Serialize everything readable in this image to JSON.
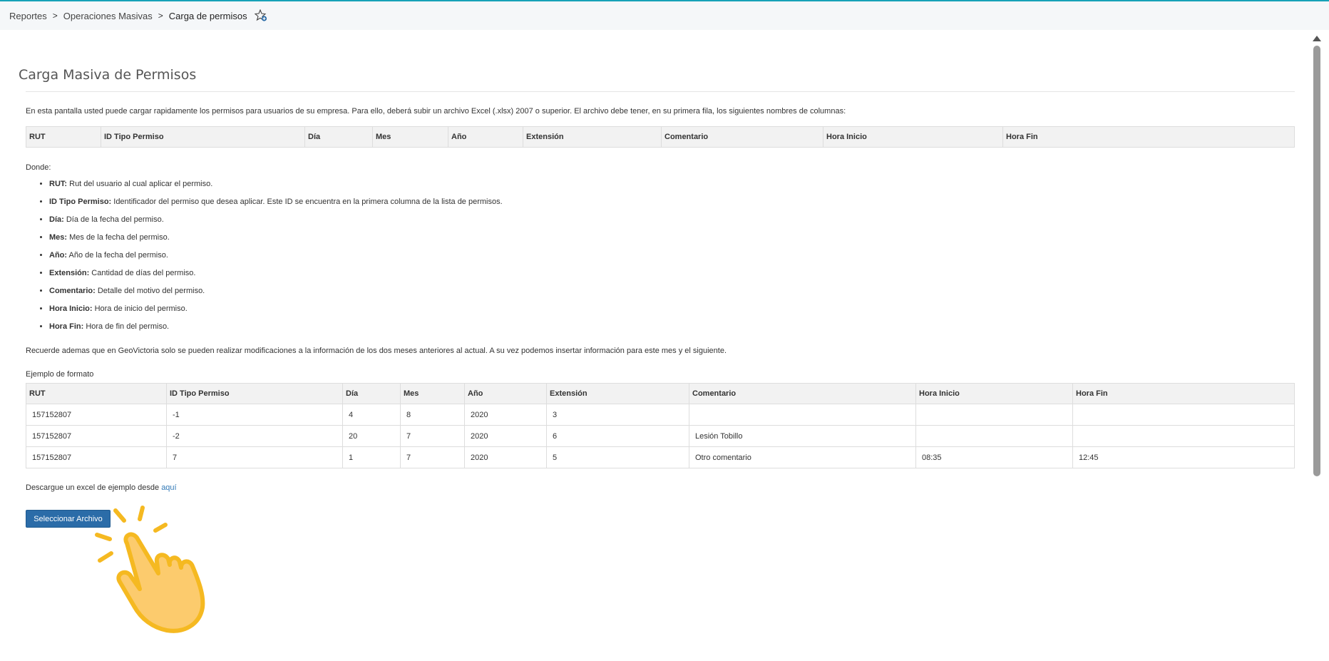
{
  "breadcrumb": {
    "items": [
      "Reportes",
      "Operaciones Masivas",
      "Carga de permisos"
    ],
    "separator": ">",
    "favorite_icon": "star-add-icon"
  },
  "page": {
    "title": "Carga Masiva de Permisos",
    "intro": "En esta pantalla usted puede cargar rapidamente los permisos para usuarios de su empresa. Para ello, deberá subir un archivo Excel (.xlsx) 2007 o superior. El archivo debe tener, en su primera fila, los siguientes nombres de columnas:",
    "columns": [
      "RUT",
      "ID Tipo Permiso",
      "Día",
      "Mes",
      "Año",
      "Extensión",
      "Comentario",
      "Hora Inicio",
      "Hora Fin"
    ],
    "donde_label": "Donde:",
    "definitions": [
      {
        "term": "RUT:",
        "desc": " Rut del usuario al cual aplicar el permiso."
      },
      {
        "term": "ID Tipo Permiso:",
        "desc": " Identificador del permiso que desea aplicar. Este ID se encuentra en la primera columna de la lista de permisos."
      },
      {
        "term": "Día:",
        "desc": " Día de la fecha del permiso."
      },
      {
        "term": "Mes:",
        "desc": " Mes de la fecha del permiso."
      },
      {
        "term": "Año:",
        "desc": " Año de la fecha del permiso."
      },
      {
        "term": "Extensión:",
        "desc": " Cantidad de días del permiso."
      },
      {
        "term": "Comentario:",
        "desc": " Detalle del motivo del permiso."
      },
      {
        "term": "Hora Inicio:",
        "desc": " Hora de inicio del permiso."
      },
      {
        "term": "Hora Fin:",
        "desc": " Hora de fin del permiso."
      }
    ],
    "note": "Recuerde ademas que en GeoVictoria solo se pueden realizar modificaciones a la información de los dos meses anteriores al actual. A su vez podemos insertar información para este mes y el siguiente.",
    "example_label": "Ejemplo de formato",
    "example_rows": [
      [
        "157152807",
        "-1",
        "4",
        "8",
        "2020",
        "3",
        "",
        "",
        ""
      ],
      [
        "157152807",
        "-2",
        "20",
        "7",
        "2020",
        "6",
        "Lesión Tobillo",
        "",
        ""
      ],
      [
        "157152807",
        "7",
        "1",
        "7",
        "2020",
        "5",
        "Otro comentario",
        "08:35",
        "12:45"
      ]
    ],
    "download_text": "Descargue un excel de ejemplo desde ",
    "download_link": "aquí",
    "select_button": "Seleccionar Archivo"
  },
  "colors": {
    "accent": "#2b6ca8",
    "link": "#337ab7",
    "header_bg": "#f2f2f2",
    "cursor": "#f5b921"
  }
}
